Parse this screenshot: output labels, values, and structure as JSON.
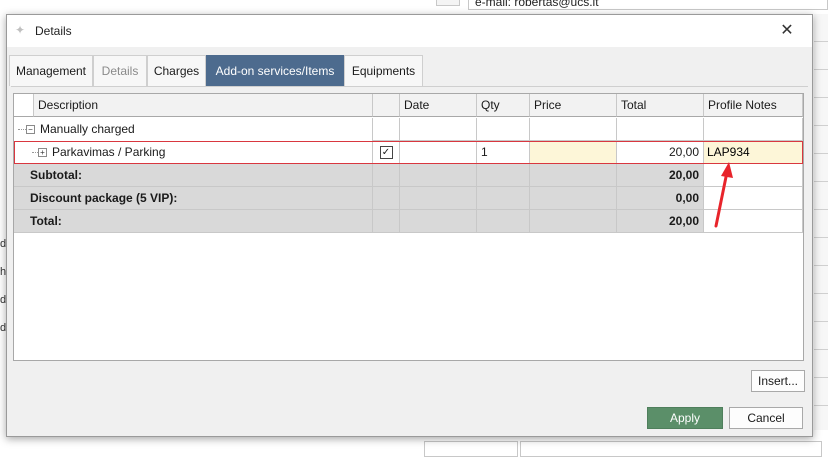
{
  "background": {
    "top_field": "e-mail: robertas@ucs.lt",
    "top_dots": "...",
    "bottom_field1": "",
    "bottom_field2": "",
    "left_letters": [
      "d",
      "h",
      "d",
      "d"
    ]
  },
  "dialog": {
    "title": "Details",
    "close_label": "✕",
    "tabs": [
      {
        "label": "Management",
        "state": "normal"
      },
      {
        "label": "Details",
        "state": "disabled"
      },
      {
        "label": "Charges",
        "state": "normal"
      },
      {
        "label": "Add-on services/Items",
        "state": "active"
      },
      {
        "label": "Equipments",
        "state": "normal"
      }
    ],
    "grid": {
      "columns": [
        "Description",
        "",
        "Date",
        "Qty",
        "Price",
        "Total",
        "Profile Notes"
      ],
      "group_row": {
        "label": "Manually charged"
      },
      "item_row": {
        "description": "Parkavimas / Parking",
        "checked": "☑",
        "date": "",
        "qty": "1",
        "price": "",
        "total": "20,00",
        "profile_note": "LAP934"
      },
      "summary_rows": [
        {
          "label": "Subtotal:",
          "total": "20,00"
        },
        {
          "label": "Discount package (5 VIP):",
          "total": "0,00"
        },
        {
          "label": "Total:",
          "total": "20,00"
        }
      ]
    },
    "insert_label": "Insert...",
    "apply_label": "Apply",
    "cancel_label": "Cancel"
  },
  "colors": {
    "active_tab": "#4d6b8e",
    "apply_button": "#5b8f69",
    "selection_outline": "#d9373f",
    "annotation_arrow": "#e8242b",
    "summary_fill": "#d9d9d9",
    "edit_fill": "#fdf6d8"
  },
  "icons": {
    "app": "sparkle-icon",
    "close": "close-icon",
    "tree_collapse": "minus-box-icon",
    "tree_expand": "plus-box-icon",
    "checkbox": "checked-checkbox-icon",
    "annotation": "red-arrow-annotation-icon"
  }
}
